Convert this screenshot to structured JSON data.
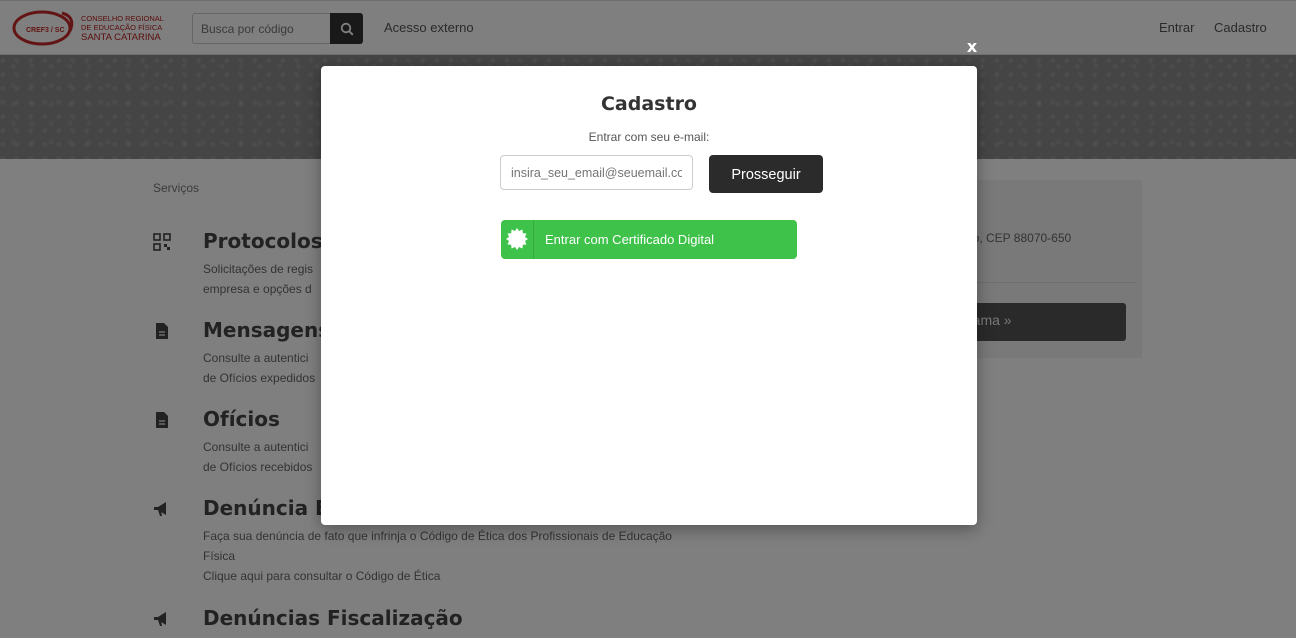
{
  "header": {
    "logo": {
      "mark_text": "CREF3 / SC",
      "lines": [
        "CONSELHO REGIONAL",
        "DE EDUCAÇÃO FÍSICA",
        "SANTA CATARINA"
      ]
    },
    "search": {
      "placeholder": "Busca por código"
    },
    "links": {
      "external": "Acesso externo",
      "login": "Entrar",
      "signup": "Cadastro"
    }
  },
  "page": {
    "breadcrumb": "Serviços",
    "services": [
      {
        "title": "Protocolos",
        "lines": [
          "Solicitações de regis",
          "empresa e opções d"
        ],
        "icon": "qr-code-icon"
      },
      {
        "title": "Mensagens E",
        "lines": [
          "Consulte a autentici",
          "de Ofícios expedidos"
        ],
        "icon": "document-icon"
      },
      {
        "title": "Ofícios",
        "lines": [
          "Consulte a autentici",
          "de Ofícios recebidos"
        ],
        "icon": "document-icon"
      },
      {
        "title": "Denúncia Ét",
        "lines": [
          "Faça sua denúncia de fato que infrinja o Código de Ética dos Profissionais de Educação",
          "Física",
          "Clique aqui para consultar o Código de Ética"
        ],
        "icon": "megaphone-icon"
      },
      {
        "title": "Denúncias Fiscalização",
        "lines": [],
        "icon": "megaphone-icon"
      }
    ],
    "side": {
      "address_fragment": "eito, CEP 88070-650",
      "button_fragment": "rama »"
    }
  },
  "modal": {
    "close_label": "x",
    "title": "Cadastro",
    "subtitle": "Entrar com seu e-mail:",
    "email_placeholder": "insira_seu_email@seuemail.com",
    "proceed_label": "Prosseguir",
    "certificate_label": "Entrar com Certificado Digital"
  },
  "colors": {
    "brand_red": "#b71c1c",
    "dark_button": "#2b2b2b",
    "certificate_green": "#3ec24a",
    "overlay": "rgba(0,0,0,0.5)"
  }
}
